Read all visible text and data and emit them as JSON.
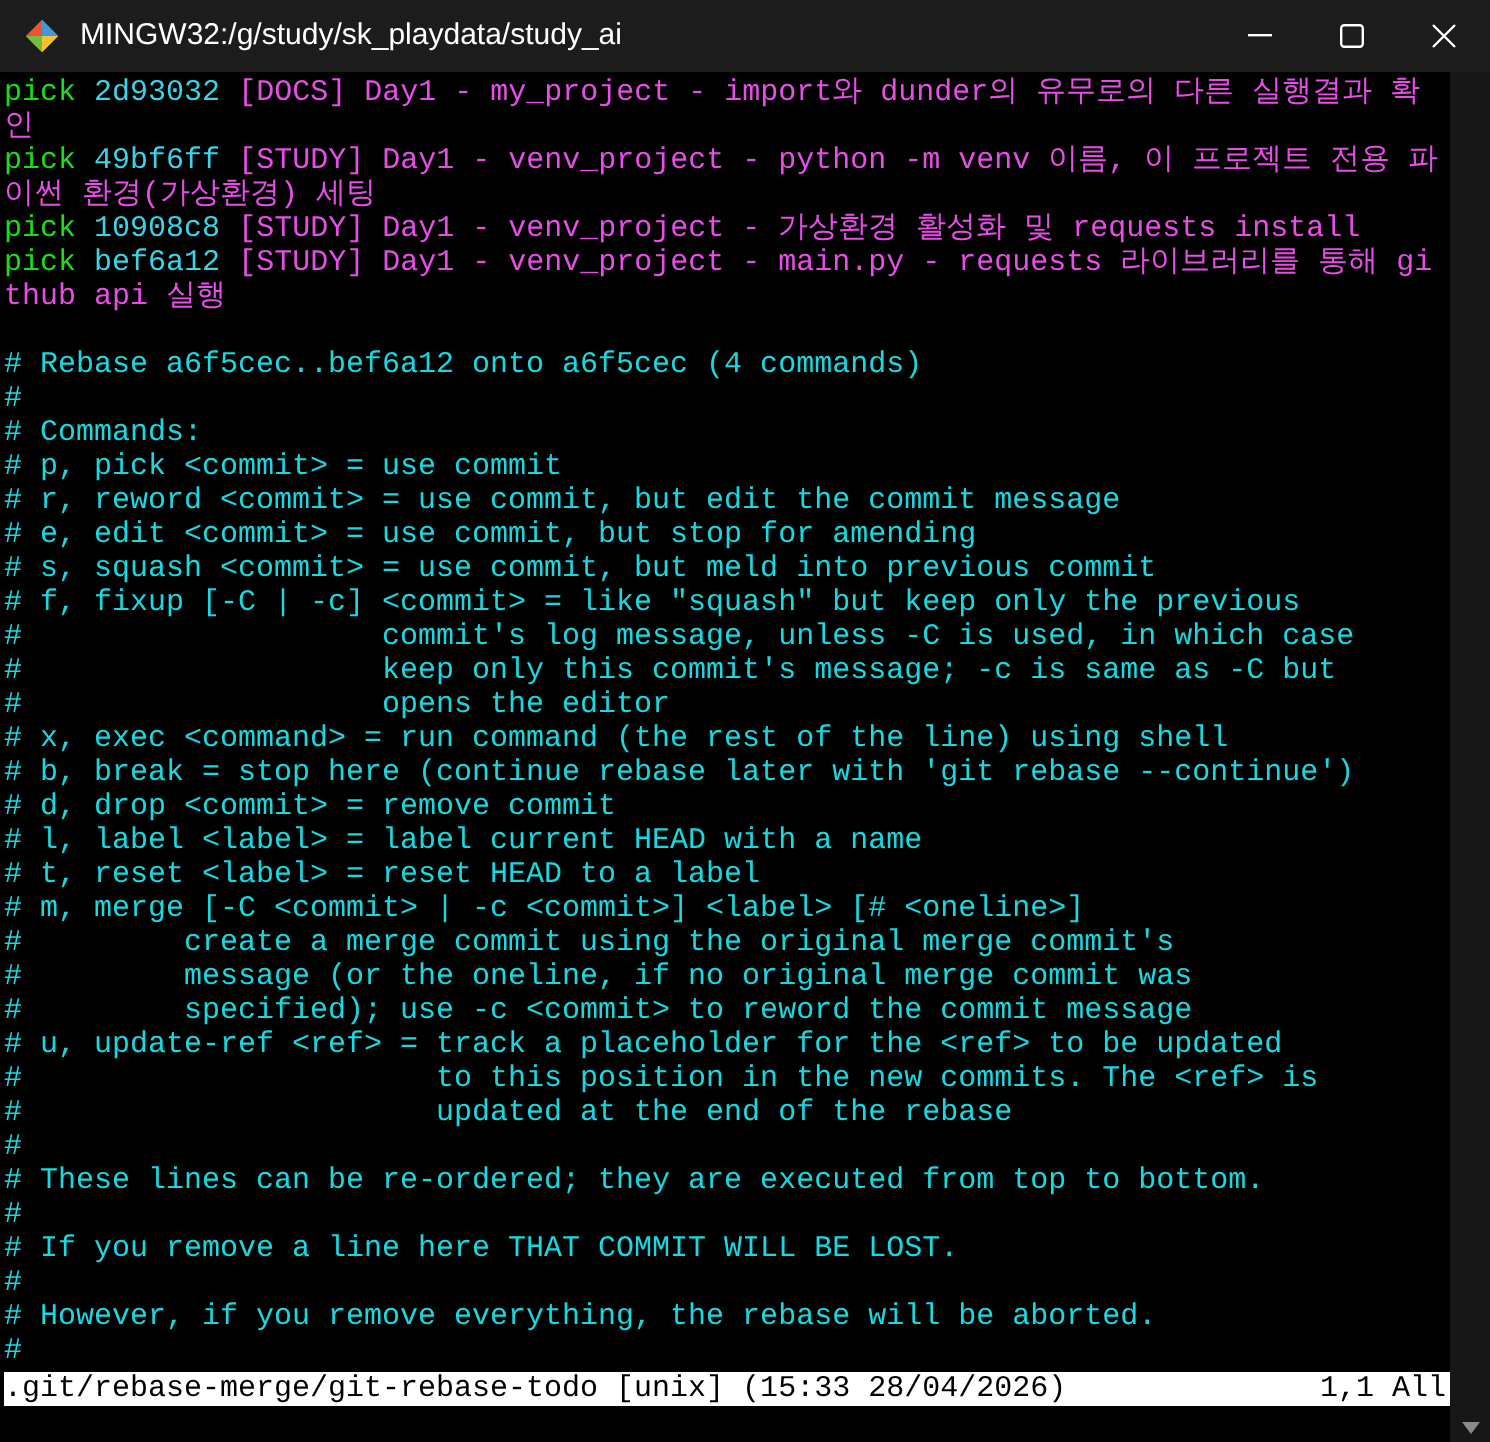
{
  "window": {
    "title": "MINGW32:/g/study/sk_playdata/study_ai"
  },
  "todo": [
    {
      "command": "pick",
      "hash": "2d93032",
      "message": "[DOCS] Day1 - my_project - import와 dunder의 유무로의 다른 실행결과 확인"
    },
    {
      "command": "pick",
      "hash": "49bf6ff",
      "message": "[STUDY] Day1 - venv_project - python -m venv 이름, 이 프로젝트 전용 파이썬 환경(가상환경) 세팅"
    },
    {
      "command": "pick",
      "hash": "10908c8",
      "message": "[STUDY] Day1 - venv_project - 가상환경 활성화 및 requests install"
    },
    {
      "command": "pick",
      "hash": "bef6a12",
      "message": "[STUDY] Day1 - venv_project - main.py - requests 라이브러리를 통해 github api 실행"
    }
  ],
  "comments": [
    "# Rebase a6f5cec..bef6a12 onto a6f5cec (4 commands)",
    "#",
    "# Commands:",
    "# p, pick <commit> = use commit",
    "# r, reword <commit> = use commit, but edit the commit message",
    "# e, edit <commit> = use commit, but stop for amending",
    "# s, squash <commit> = use commit, but meld into previous commit",
    "# f, fixup [-C | -c] <commit> = like \"squash\" but keep only the previous",
    "#                    commit's log message, unless -C is used, in which case",
    "#                    keep only this commit's message; -c is same as -C but",
    "#                    opens the editor",
    "# x, exec <command> = run command (the rest of the line) using shell",
    "# b, break = stop here (continue rebase later with 'git rebase --continue')",
    "# d, drop <commit> = remove commit",
    "# l, label <label> = label current HEAD with a name",
    "# t, reset <label> = reset HEAD to a label",
    "# m, merge [-C <commit> | -c <commit>] <label> [# <oneline>]",
    "#         create a merge commit using the original merge commit's",
    "#         message (or the oneline, if no original merge commit was",
    "#         specified); use -c <commit> to reword the commit message",
    "# u, update-ref <ref> = track a placeholder for the <ref> to be updated",
    "#                       to this position in the new commits. The <ref> is",
    "#                       updated at the end of the rebase",
    "#",
    "# These lines can be re-ordered; they are executed from top to bottom.",
    "#",
    "# If you remove a line here THAT COMMIT WILL BE LOST.",
    "#",
    "# However, if you remove everything, the rebase will be aborted.",
    "#"
  ],
  "status_bar": {
    "file": ".git/rebase-merge/git-rebase-todo [unix] (15:33 28/04/2026)",
    "position": "1,1 All"
  }
}
